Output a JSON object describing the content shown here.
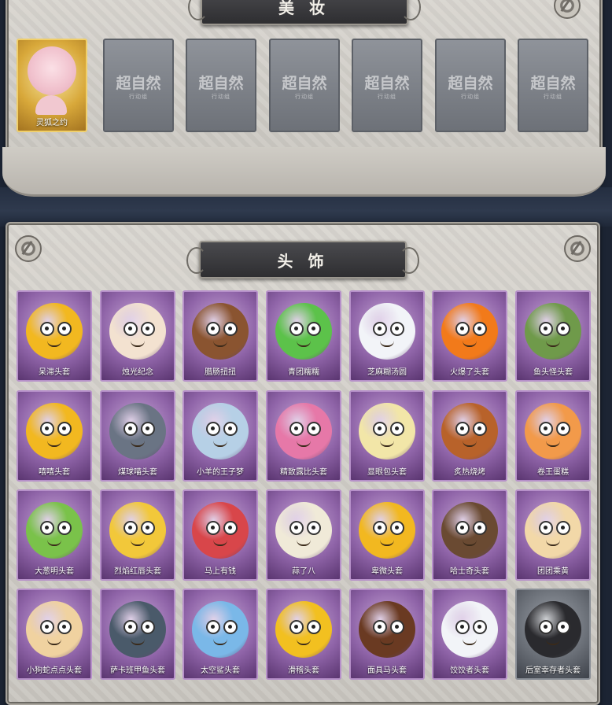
{
  "sections": {
    "cosmetics": {
      "title": "美 妆",
      "featured": {
        "label": "灵狐之约"
      },
      "locked_watermark": "超自然",
      "locked_sub": "行动组"
    },
    "headwear": {
      "title": "头 饰",
      "items": [
        {
          "label": "呆滞头套",
          "icon": "stunned-face-icon",
          "color": "#f2b820"
        },
        {
          "label": "烛光纪念",
          "icon": "candle-icon",
          "color": "#f3e2d0"
        },
        {
          "label": "腊肠扭扭",
          "icon": "dachshund-icon",
          "color": "#8a5430"
        },
        {
          "label": "青团糯糯",
          "icon": "green-rice-ball-icon",
          "color": "#5cc24a"
        },
        {
          "label": "芝麻糊汤圆",
          "icon": "dumpling-icon",
          "color": "#f2f4f8"
        },
        {
          "label": "火爆了头套",
          "icon": "fire-spirit-icon",
          "color": "#f27a1a"
        },
        {
          "label": "鱼头怪头套",
          "icon": "fish-monster-icon",
          "color": "#6f9a4a"
        },
        {
          "label": "嘻嘻头套",
          "icon": "grin-face-icon",
          "color": "#f2b820"
        },
        {
          "label": "煤球喵头套",
          "icon": "gray-cat-icon",
          "color": "#6a7484"
        },
        {
          "label": "小羊的王子梦",
          "icon": "lamb-prince-icon",
          "color": "#b6d0e6"
        },
        {
          "label": "精致露比头套",
          "icon": "pink-beaver-icon",
          "color": "#e678a8"
        },
        {
          "label": "显眼包头套",
          "icon": "lightbulb-icon",
          "color": "#f2e6a8"
        },
        {
          "label": "炙热烧烤",
          "icon": "bbq-meat-icon",
          "color": "#b8622a"
        },
        {
          "label": "卷王蛋糕",
          "icon": "roll-cake-icon",
          "color": "#f29a4a"
        },
        {
          "label": "大葱明头套",
          "icon": "scallion-icon",
          "color": "#7ac24a"
        },
        {
          "label": "烈焰红唇头套",
          "icon": "pikachu-lips-icon",
          "color": "#f2c83a"
        },
        {
          "label": "马上有钱",
          "icon": "red-horse-icon",
          "color": "#d8464a"
        },
        {
          "label": "蒜了八",
          "icon": "garlic-icon",
          "color": "#f0ead8"
        },
        {
          "label": "卑微头套",
          "icon": "humble-face-icon",
          "color": "#f2b820"
        },
        {
          "label": "哈士奇头套",
          "icon": "husky-icon",
          "color": "#6a4a32"
        },
        {
          "label": "团团乘黄",
          "icon": "cat-bun-icon",
          "color": "#f2d8a8"
        },
        {
          "label": "小狗蛇点点头套",
          "icon": "snake-dog-icon",
          "color": "#f0d2a0"
        },
        {
          "label": "萨卡班甲鱼头套",
          "icon": "sacabambaspis-icon",
          "color": "#4a5a6a"
        },
        {
          "label": "太空鲨头套",
          "icon": "space-shark-icon",
          "color": "#7ab8e8"
        },
        {
          "label": "滑稽头套",
          "icon": "funny-face-icon",
          "color": "#f2c020"
        },
        {
          "label": "面具马头套",
          "icon": "horse-mask-icon",
          "color": "#6a3a22"
        },
        {
          "label": "饺饺者头套",
          "icon": "cloud-dumpling-icon",
          "color": "#f2f4f8"
        },
        {
          "label": "后室幸存者头套",
          "icon": "gas-mask-icon",
          "color": "#2a2a2e"
        }
      ]
    }
  }
}
